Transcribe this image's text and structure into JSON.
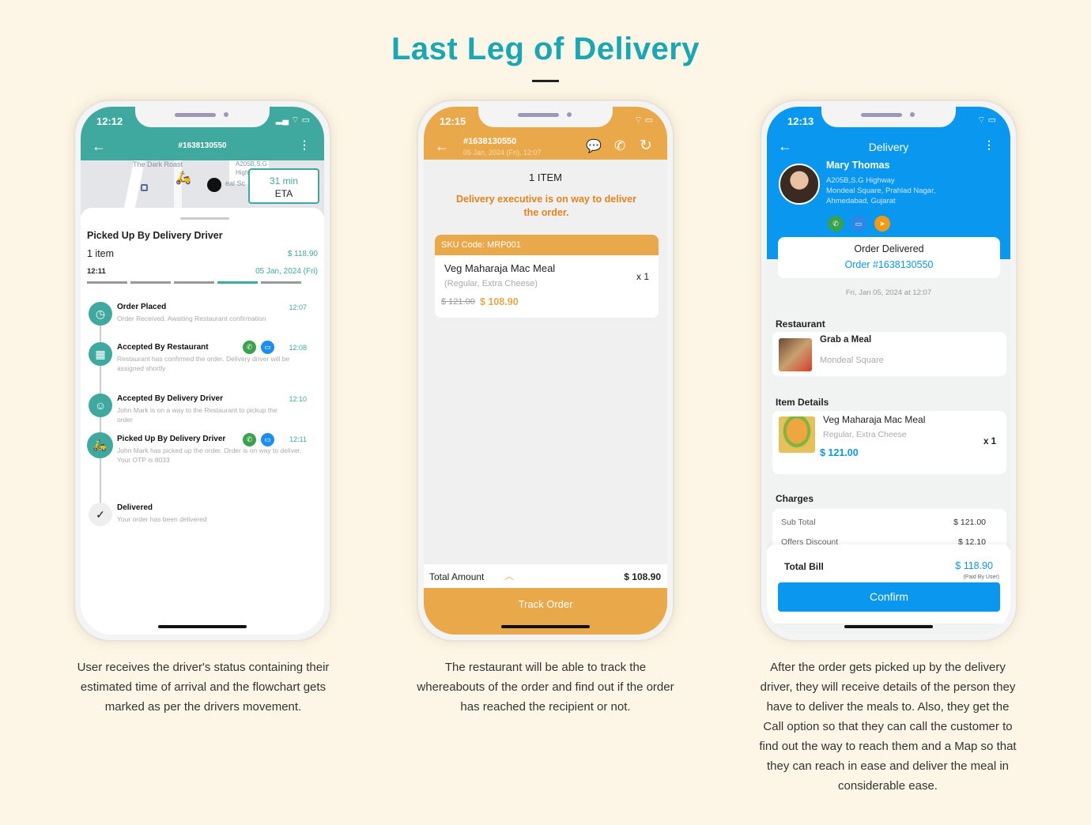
{
  "page": {
    "title": "Last Leg of Delivery"
  },
  "phone1": {
    "time": "12:12",
    "header": "#1638130550",
    "map": {
      "label1": "The Dark Roast",
      "label2": "A205B,S.G",
      "label3": "High",
      "label4": "eal Sc",
      "eta_value": "31 min",
      "eta_label": "ETA"
    },
    "status": "Picked Up By Delivery Driver",
    "items": "1 item",
    "amount": "$ 118.90",
    "clock": "12:11",
    "date": "05 Jan, 2024 (Fri)",
    "progress_step": 4,
    "progress_total": 5,
    "timeline": [
      {
        "title": "Order Placed",
        "desc": "Order Received. Awaiting Restaurant confirmation",
        "time": "12:07",
        "icon": "clock-icon"
      },
      {
        "title": "Accepted By Restaurant",
        "desc": "Restaurant has confirmed the order. Delivery driver will be assigned shortly",
        "time": "12:08",
        "icon": "store-icon"
      },
      {
        "title": "Accepted By Delivery Driver",
        "desc": "John Mark is on a way to the Restaurant to pickup the order",
        "time": "12:10",
        "icon": "driver-icon"
      },
      {
        "title": "Picked Up By Delivery Driver",
        "desc": "John Mark has picked up the order. Order is on way to deliver. Your OTP is 8033",
        "time": "12:11",
        "icon": "scooter-icon"
      },
      {
        "title": "Delivered",
        "desc": "Your order has been delivered",
        "time": "",
        "icon": "check-icon"
      }
    ]
  },
  "phone2": {
    "time": "12:15",
    "order": "#1638130550",
    "datetime": "05 Jan, 2024 (Fri),  12:07",
    "item_count": "1 ITEM",
    "message": "Delivery executive is on way to deliver the order.",
    "sku": "SKU Code: MRP001",
    "item_name": "Veg Maharaja Mac Meal",
    "item_options": "(Regular, Extra Cheese)",
    "old_price": "$ 121.00",
    "price": "$ 108.90",
    "qty": "x 1",
    "total_label": "Total Amount",
    "total": "$ 108.90",
    "track": "Track Order"
  },
  "phone3": {
    "time": "12:13",
    "header": "Delivery",
    "name": "Mary Thomas",
    "address": [
      "A205B,S.G Highway",
      "Mondeal Square, Prahlad Nagar,",
      "Ahmedabad, Gujarat"
    ],
    "status": "Order Delivered",
    "order": "Order #1638130550",
    "date": "Fri, Jan 05, 2024 at 12:07",
    "restaurant_label": "Restaurant",
    "restaurant_name": "Grab a Meal",
    "restaurant_area": "Mondeal Square",
    "items_label": "Item Details",
    "item_name": "Veg Maharaja Mac Meal",
    "item_options": "Regular, Extra Cheese",
    "item_price": "$ 121.00",
    "qty": "x 1",
    "charges_label": "Charges",
    "subtotal_label": "Sub Total",
    "subtotal": "$ 121.00",
    "discount_label": "Offers Discount",
    "discount": "$ 12.10",
    "total_label": "Total Bill",
    "total": "$ 118.90",
    "paid_by": "(Paid By User)",
    "confirm": "Confirm"
  },
  "captions": [
    "User receives the driver's status containing their estimated time of arrival and the flowchart gets marked as per the drivers movement.",
    "The restaurant will be able to track the whereabouts of the order and find out if the order has reached the recipient or not.",
    "After the order gets picked up by the delivery driver, they will receive details of the person they have to deliver the meals to. Also, they get the Call option so that they can call the customer to find out the way to reach them and a Map so that they can reach in ease and deliver the meal in considerable ease."
  ],
  "colors": {
    "title": "#18a7b5",
    "teal": "#3fa9a0",
    "orange": "#e9a94a",
    "blue": "#0a97f0"
  }
}
